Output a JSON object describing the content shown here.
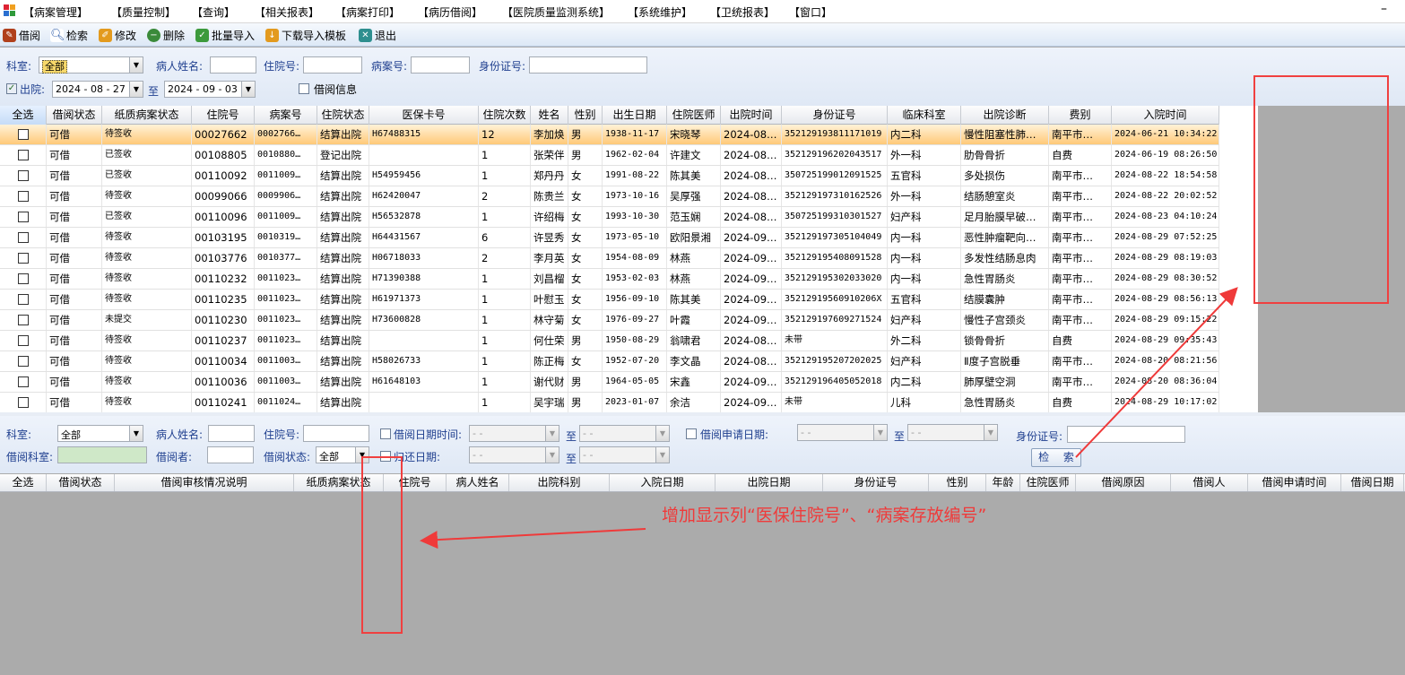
{
  "menubar": {
    "items": [
      "【病案管理】",
      "【质量控制】",
      "【查询】",
      "【相关报表】",
      "【病案打印】",
      "【病历借阅】",
      "【医院质量监测系统】",
      "【系统维护】",
      "【卫统报表】",
      "【窗口】"
    ],
    "minimize": "–"
  },
  "toolbar": {
    "items": [
      {
        "label": "借阅",
        "icon": "borrow-icon",
        "color": "#b0401c"
      },
      {
        "label": "检索",
        "icon": "magnifier-icon",
        "color": "#2b5aa8"
      },
      {
        "label": "修改",
        "icon": "edit-icon",
        "color": "#e39a1e"
      },
      {
        "label": "删除",
        "icon": "delete-icon",
        "color": "#3a8a3a"
      },
      {
        "label": "批量导入",
        "icon": "batch-import-icon",
        "color": "#3c9a3c"
      },
      {
        "label": "下载导入模板",
        "icon": "download-template-icon",
        "color": "#e39a1e"
      },
      {
        "label": "退出",
        "icon": "exit-icon",
        "color": "#2e8f8f"
      }
    ]
  },
  "filter1": {
    "dept_label": "科室:",
    "dept_value": "全部",
    "patient_label": "病人姓名:",
    "inpatient_label": "住院号:",
    "case_label": "病案号:",
    "id_label": "身份证号:",
    "discharge_label": "出院:",
    "date_from": "2024 - 08 - 27",
    "date_to": "2024 - 09 - 03",
    "to": "至",
    "borrow_info_label": "借阅信息",
    "discharge_check": "✓"
  },
  "grid1": {
    "headers": [
      "全选",
      "借阅状态",
      "纸质病案状态",
      "住院号",
      "病案号",
      "住院状态",
      "医保卡号",
      "住院次数",
      "姓名",
      "性别",
      "出生日期",
      "住院医师",
      "出院时间",
      "身份证号",
      "临床科室",
      "出院诊断",
      "费别",
      "入院时间"
    ],
    "rows": [
      [
        "可借",
        "待签收",
        "00027662",
        "0002766…",
        "结算出院",
        "H67488315",
        "12",
        "李加焕",
        "男",
        "1938-11-17",
        "宋晓琴",
        "2024-08…",
        "352129193811171019",
        "内二科",
        "慢性阻塞性肺…",
        "南平市…",
        "2024-06-21 10:34:22"
      ],
      [
        "可借",
        "已签收",
        "00108805",
        "0010880…",
        "登记出院",
        "",
        "1",
        "张荣伴",
        "男",
        "1962-02-04",
        "许建文",
        "2024-08…",
        "352129196202043517",
        "外一科",
        "肋骨骨折",
        "自费",
        "2024-06-19 08:26:50"
      ],
      [
        "可借",
        "已签收",
        "00110092",
        "0011009…",
        "结算出院",
        "H54959456",
        "1",
        "郑丹丹",
        "女",
        "1991-08-22",
        "陈其美",
        "2024-08…",
        "350725199012091525",
        "五官科",
        "多处损伤",
        "南平市…",
        "2024-08-22 18:54:58"
      ],
      [
        "可借",
        "待签收",
        "00099066",
        "0009906…",
        "结算出院",
        "H62420047",
        "2",
        "陈贵兰",
        "女",
        "1973-10-16",
        "吴厚强",
        "2024-08…",
        "352129197310162526",
        "外一科",
        "结肠憩室炎",
        "南平市…",
        "2024-08-22 20:02:52"
      ],
      [
        "可借",
        "已签收",
        "00110096",
        "0011009…",
        "结算出院",
        "H56532878",
        "1",
        "许绍梅",
        "女",
        "1993-10-30",
        "范玉娴",
        "2024-08…",
        "350725199310301527",
        "妇产科",
        "足月胎膜早破…",
        "南平市…",
        "2024-08-23 04:10:24"
      ],
      [
        "可借",
        "待签收",
        "00103195",
        "0010319…",
        "结算出院",
        "H64431567",
        "6",
        "许昱秀",
        "女",
        "1973-05-10",
        "欧阳景湘",
        "2024-09…",
        "352129197305104049",
        "内一科",
        "恶性肿瘤靶向…",
        "南平市…",
        "2024-08-29 07:52:25"
      ],
      [
        "可借",
        "待签收",
        "00103776",
        "0010377…",
        "结算出院",
        "H06718033",
        "2",
        "李月英",
        "女",
        "1954-08-09",
        "林燕",
        "2024-09…",
        "352129195408091528",
        "内一科",
        "多发性结肠息肉",
        "南平市…",
        "2024-08-29 08:19:03"
      ],
      [
        "可借",
        "待签收",
        "00110232",
        "0011023…",
        "结算出院",
        "H71390388",
        "1",
        "刘昌榴",
        "女",
        "1953-02-03",
        "林燕",
        "2024-09…",
        "352129195302033020",
        "内一科",
        "急性胃肠炎",
        "南平市…",
        "2024-08-29 08:30:52"
      ],
      [
        "可借",
        "待签收",
        "00110235",
        "0011023…",
        "结算出院",
        "H61971373",
        "1",
        "叶慰玉",
        "女",
        "1956-09-10",
        "陈其美",
        "2024-09…",
        "35212919560910206X",
        "五官科",
        "结膜囊肿",
        "南平市…",
        "2024-08-29 08:56:13"
      ],
      [
        "可借",
        "未提交",
        "00110230",
        "0011023…",
        "结算出院",
        "H73600828",
        "1",
        "林守菊",
        "女",
        "1976-09-27",
        "叶霞",
        "2024-09…",
        "352129197609271524",
        "妇产科",
        "慢性子宫颈炎",
        "南平市…",
        "2024-08-29 09:15:22"
      ],
      [
        "可借",
        "待签收",
        "00110237",
        "0011023…",
        "结算出院",
        "",
        "1",
        "何仕荣",
        "男",
        "1950-08-29",
        "翁啸君",
        "2024-08…",
        "未带",
        "外二科",
        "锁骨骨折",
        "自费",
        "2024-08-29 09:35:43"
      ],
      [
        "可借",
        "待签收",
        "00110034",
        "0011003…",
        "结算出院",
        "H58026733",
        "1",
        "陈正梅",
        "女",
        "1952-07-20",
        "李文晶",
        "2024-08…",
        "352129195207202025",
        "妇产科",
        "Ⅱ度子宫脱垂",
        "南平市…",
        "2024-08-20 08:21:56"
      ],
      [
        "可借",
        "待签收",
        "00110036",
        "0011003…",
        "结算出院",
        "H61648103",
        "1",
        "谢代财",
        "男",
        "1964-05-05",
        "宋鑫",
        "2024-09…",
        "352129196405052018",
        "内二科",
        "肺厚壁空洞",
        "南平市…",
        "2024-08-20 08:36:04"
      ],
      [
        "可借",
        "待签收",
        "00110241",
        "0011024…",
        "结算出院",
        "",
        "1",
        "吴宇瑞",
        "男",
        "2023-01-07",
        "余洁",
        "2024-09…",
        "未带",
        "儿科",
        "急性胃肠炎",
        "自费",
        "2024-08-29 10:17:02"
      ]
    ]
  },
  "filter2": {
    "dept_label": "科室:",
    "dept_value": "全部",
    "patient_label": "病人姓名:",
    "inpatient_label": "住院号:",
    "borrow_date_label": "借阅日期时间:",
    "apply_date_label": "借阅申请日期:",
    "id_label": "身份证号:",
    "borrow_dept_label": "借阅科室:",
    "borrower_label": "借阅者:",
    "status_label": "借阅状态:",
    "status_value": "全部",
    "return_date_label": "归还日期:",
    "date_placeholder": "- -",
    "to": "至",
    "search_label": "检 索"
  },
  "grid2": {
    "headers": [
      "全选",
      "借阅状态",
      "借阅审核情况说明",
      "纸质病案状态",
      "住院号",
      "病人姓名",
      "出院科别",
      "入院日期",
      "出院日期",
      "身份证号",
      "性别",
      "年龄",
      "住院医师",
      "借阅原因",
      "借阅人",
      "借阅申请时间",
      "借阅日期"
    ]
  },
  "annotation": {
    "text": "增加显示列“医保住院号”、“病案存放编号”",
    "color": "#ef3a3a"
  }
}
